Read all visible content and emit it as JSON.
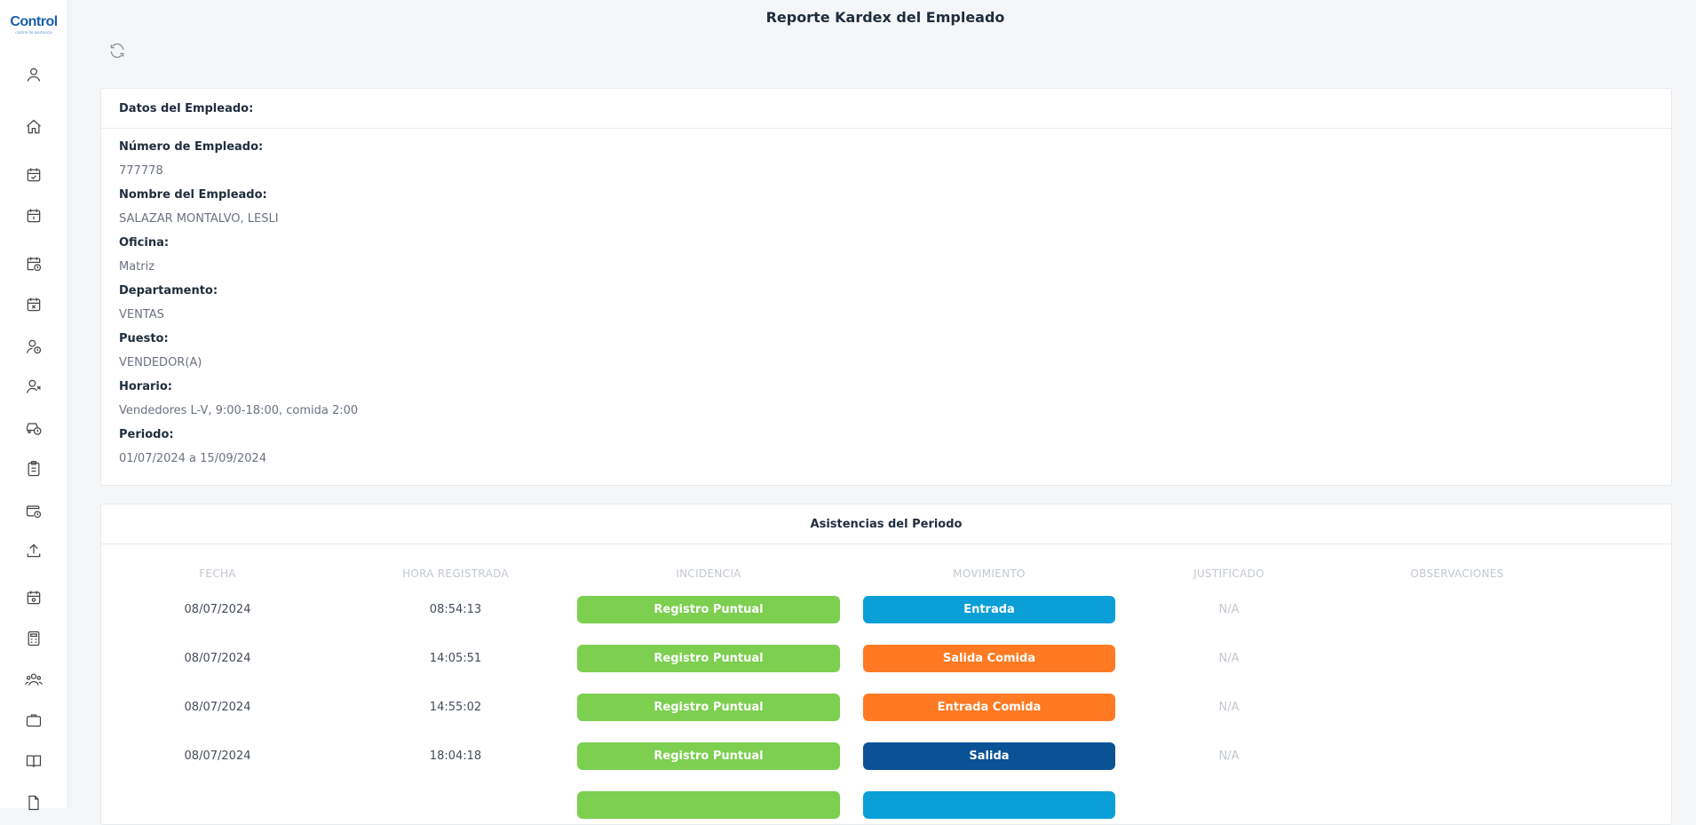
{
  "app": {
    "logo_text": "Control",
    "logo_sub": "control de asistencia",
    "page_title": "Reporte Kardex del Empleado"
  },
  "sidebar": {
    "items": [
      {
        "icon": "user-icon"
      },
      {
        "icon": "home-icon"
      },
      {
        "icon": "calendar-check-icon"
      },
      {
        "icon": "calendar-day-icon"
      },
      {
        "icon": "calendar-clock-icon"
      },
      {
        "icon": "calendar-x-icon"
      },
      {
        "icon": "user-clock-icon"
      },
      {
        "icon": "user-x-icon"
      },
      {
        "icon": "car-clock-icon"
      },
      {
        "icon": "clipboard-icon"
      },
      {
        "icon": "wallet-clock-icon"
      },
      {
        "icon": "upload-icon"
      },
      {
        "icon": "calendar-star-icon"
      },
      {
        "icon": "calculator-icon"
      },
      {
        "icon": "users-icon"
      },
      {
        "icon": "briefcase-icon"
      },
      {
        "icon": "book-icon"
      },
      {
        "icon": "document-icon"
      }
    ]
  },
  "employee": {
    "header": "Datos del Empleado:",
    "fields": [
      {
        "label": "Número de Empleado:",
        "value": "777778"
      },
      {
        "label": "Nombre del Empleado:",
        "value": "SALAZAR MONTALVO, LESLI"
      },
      {
        "label": "Oficina:",
        "value": "Matriz"
      },
      {
        "label": "Departamento:",
        "value": "VENTAS"
      },
      {
        "label": "Puesto:",
        "value": "VENDEDOR(A)"
      },
      {
        "label": "Horario:",
        "value": "Vendedores L-V, 9:00-18:00, comida 2:00"
      },
      {
        "label": "Periodo:",
        "value": "01/07/2024 a 15/09/2024"
      }
    ]
  },
  "attendance": {
    "header": "Asistencias del Periodo",
    "columns": [
      "FECHA",
      "HORA REGISTRADA",
      "INCIDENCIA",
      "MOVIMIENTO",
      "JUSTIFICADO",
      "OBSERVACIONES"
    ],
    "rows": [
      {
        "fecha": "08/07/2024",
        "hora": "08:54:13",
        "incidencia": "Registro Puntual",
        "movimiento": "Entrada",
        "justificado": "N/A",
        "observaciones": ""
      },
      {
        "fecha": "08/07/2024",
        "hora": "14:05:51",
        "incidencia": "Registro Puntual",
        "movimiento": "Salida Comida",
        "justificado": "N/A",
        "observaciones": ""
      },
      {
        "fecha": "08/07/2024",
        "hora": "14:55:02",
        "incidencia": "Registro Puntual",
        "movimiento": "Entrada Comida",
        "justificado": "N/A",
        "observaciones": ""
      },
      {
        "fecha": "08/07/2024",
        "hora": "18:04:18",
        "incidencia": "Registro Puntual",
        "movimiento": "Salida",
        "justificado": "N/A",
        "observaciones": ""
      },
      {
        "fecha": "",
        "hora": "",
        "incidencia": "",
        "movimiento": "",
        "justificado": "",
        "observaciones": ""
      }
    ],
    "colors": {
      "incidencia": "#7ccf4f",
      "entrada": "#0b9fd8",
      "comida": "#ff7a22",
      "salida": "#0a5196"
    }
  }
}
